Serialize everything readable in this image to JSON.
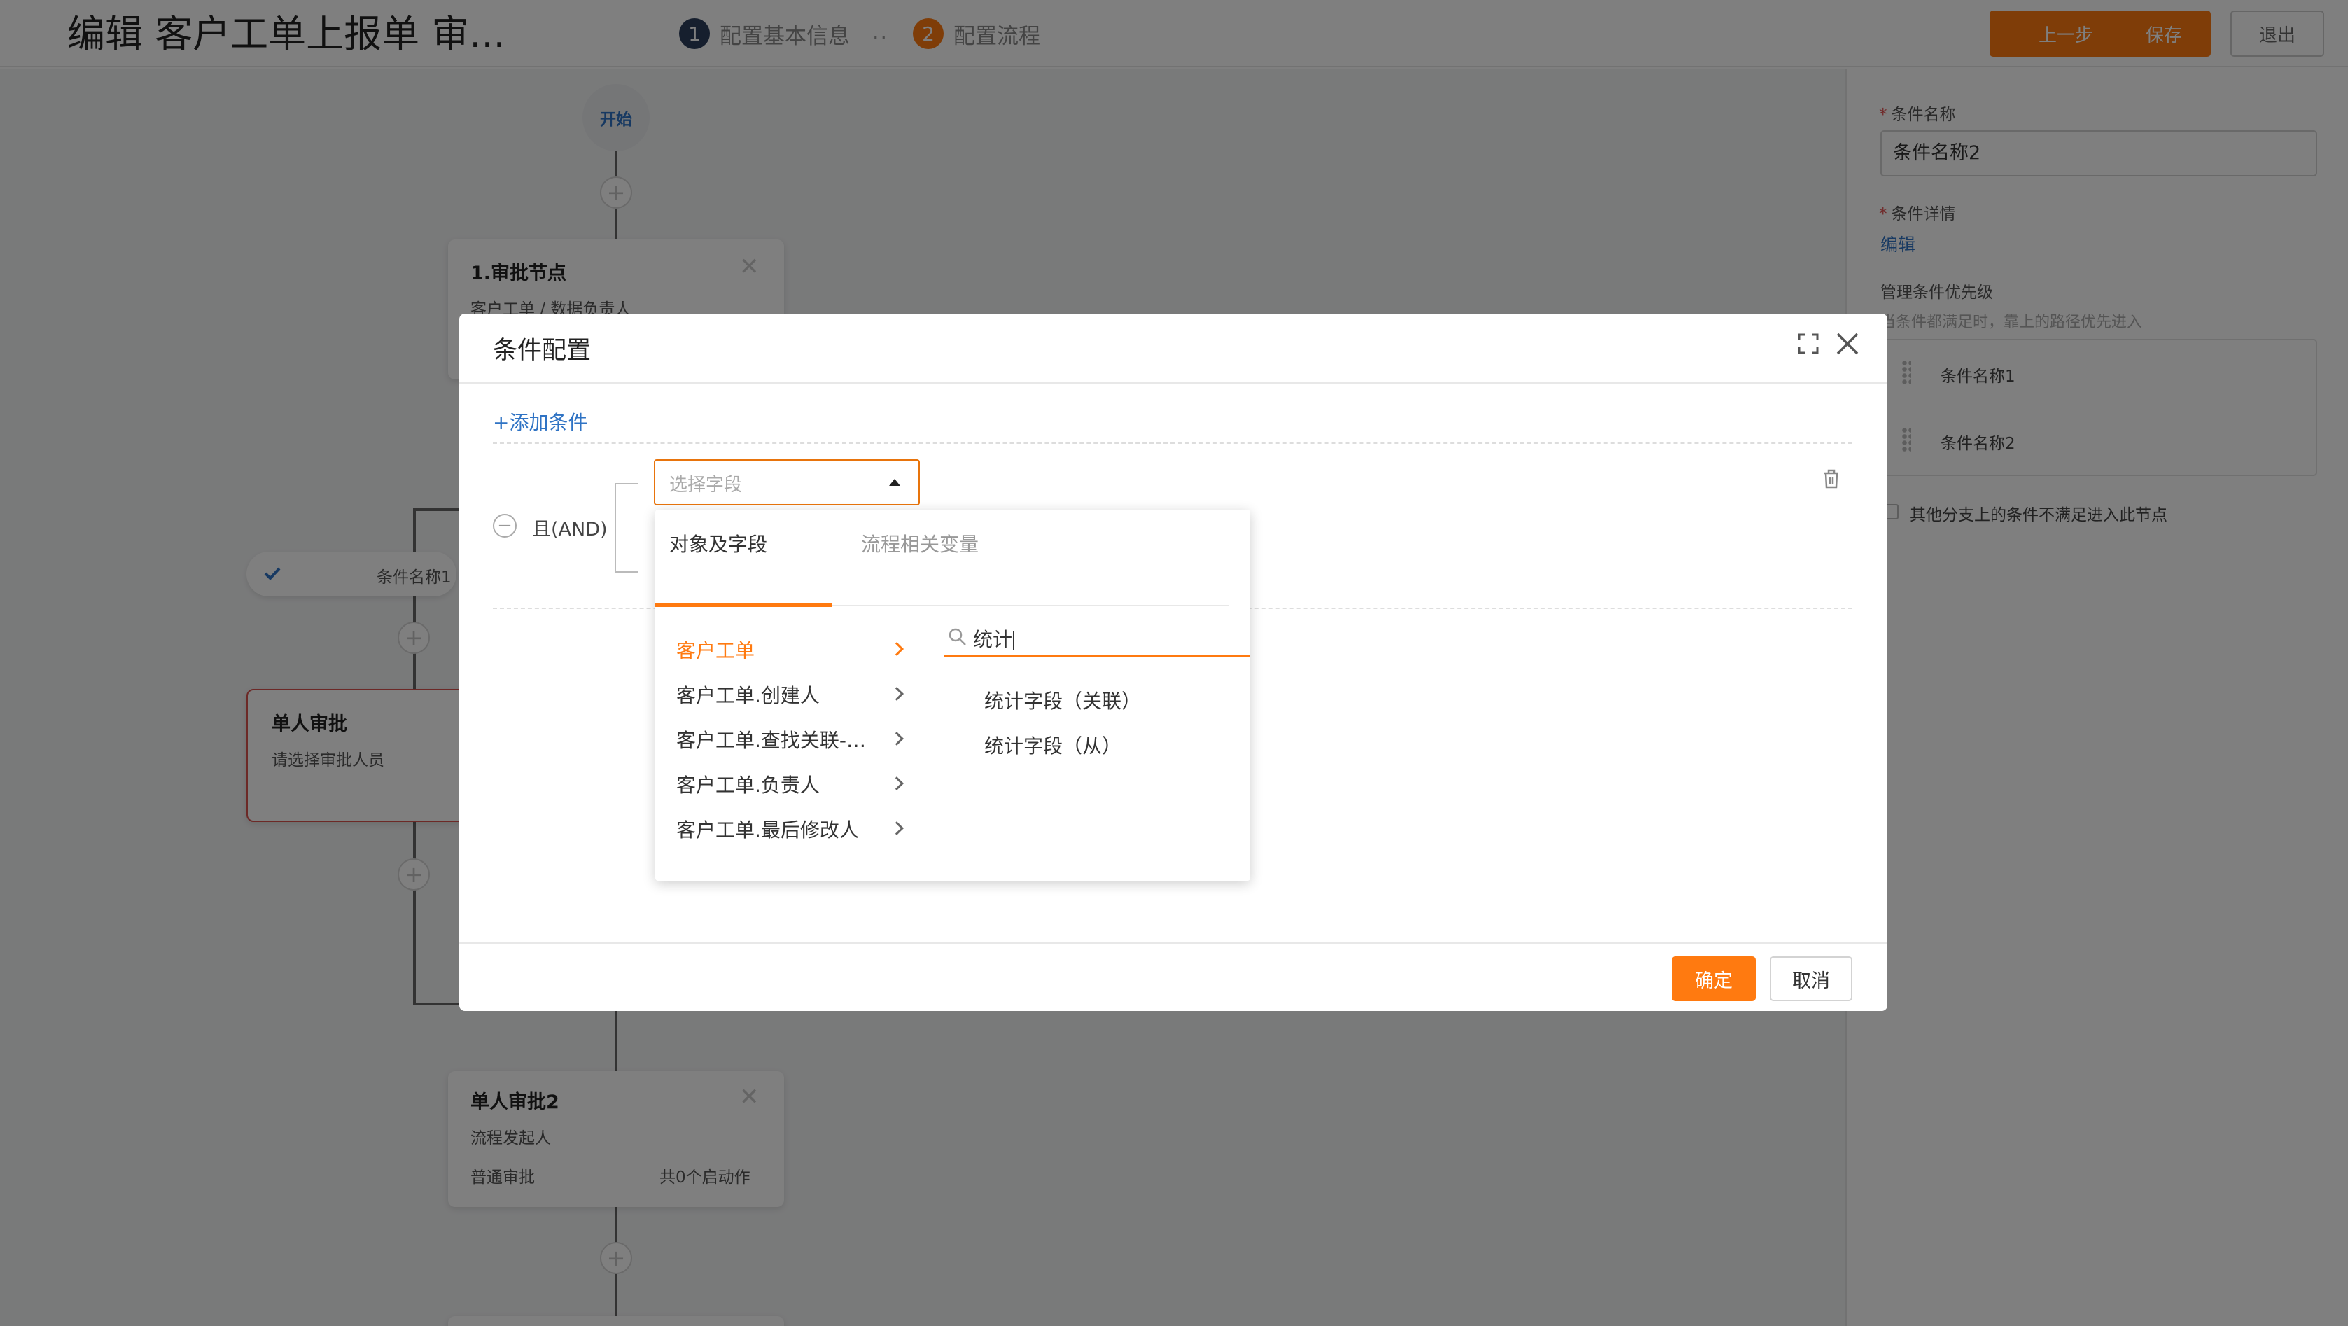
{
  "header": {
    "title": "编辑 客户工单上报单 审...",
    "steps": [
      {
        "num": "1",
        "label": "配置基本信息"
      },
      {
        "num": "2",
        "label": "配置流程"
      }
    ],
    "separator": "..",
    "buttons": {
      "prev": "上一步",
      "save": "保存",
      "exit": "退出"
    }
  },
  "flow": {
    "start": "开始",
    "add_symbol": "+",
    "approval_node": {
      "title": "1.审批节点",
      "desc": "客户工单 / 数据负责人"
    },
    "condition_branch": {
      "label": "条件名称1"
    },
    "single_approval": {
      "title": "单人审批",
      "desc": "请选择审批人员"
    },
    "single_approval_2": {
      "title": "单人审批2",
      "desc": "流程发起人",
      "type": "普通审批",
      "actions": "共0个启动作"
    }
  },
  "right_panel": {
    "name_label": "条件名称",
    "name_value": "条件名称2",
    "detail_label": "条件详情",
    "edit_link": "编辑",
    "priority_label": "管理条件优先级",
    "priority_hint": "当条件都满足时，靠上的路径优先进入",
    "priority_items": [
      "条件名称1",
      "条件名称2"
    ],
    "fallback_checkbox": "其他分支上的条件不满足进入此节点"
  },
  "modal": {
    "title": "条件配置",
    "add_condition": "+添加条件",
    "logic_toggle": "−",
    "logic": "且(AND)",
    "field_select_placeholder": "选择字段",
    "confirm": "确定",
    "cancel": "取消"
  },
  "dropdown": {
    "tabs": [
      "对象及字段",
      "流程相关变量"
    ],
    "objects": [
      "客户工单",
      "客户工单.创建人",
      "客户工单.查找关联-物料",
      "客户工单.负责人",
      "客户工单.最后修改人"
    ],
    "search_value": "统计",
    "results": [
      "统计字段（关联）",
      "统计字段（从）"
    ]
  },
  "colors": {
    "accent": "#ff7a10",
    "link": "#2f73c4",
    "step_done": "#2c3e5c"
  },
  "icons": [
    "maximize-icon",
    "close-icon",
    "trash-icon",
    "search-icon",
    "chevron-right-icon",
    "check-icon",
    "caret-up-icon",
    "drag-handle-icon"
  ]
}
